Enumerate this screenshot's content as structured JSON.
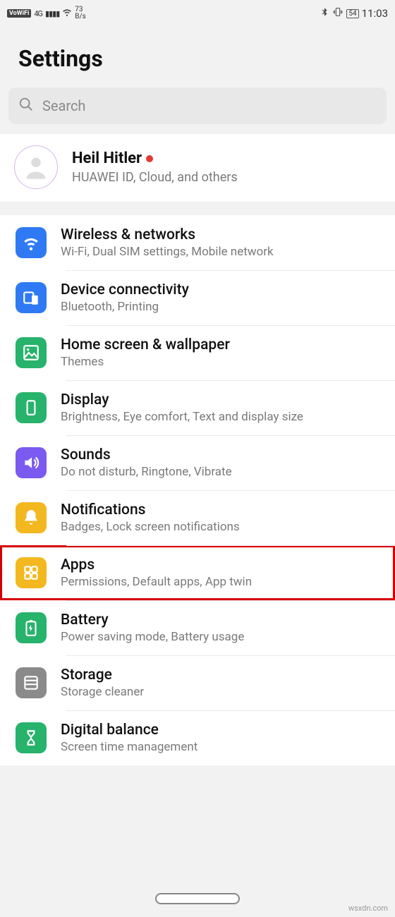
{
  "status": {
    "vowifi": "VoWiFi",
    "network": "4G",
    "rate_top": "73",
    "rate_bottom": "B/s",
    "battery": "54",
    "time": "11:03"
  },
  "header": {
    "title": "Settings"
  },
  "search": {
    "placeholder": "Search"
  },
  "account": {
    "name": "Heil Hitler",
    "sub": "HUAWEI ID, Cloud, and others"
  },
  "items": [
    {
      "id": "wireless",
      "title": "Wireless & networks",
      "sub": "Wi-Fi, Dual SIM settings, Mobile network",
      "color": "#2f7af4",
      "icon": "wifi"
    },
    {
      "id": "device",
      "title": "Device connectivity",
      "sub": "Bluetooth, Printing",
      "color": "#2f7af4",
      "icon": "devices"
    },
    {
      "id": "home",
      "title": "Home screen & wallpaper",
      "sub": "Themes",
      "color": "#27b36b",
      "icon": "image"
    },
    {
      "id": "display",
      "title": "Display",
      "sub": "Brightness, Eye comfort, Text and display size",
      "color": "#27b36b",
      "icon": "phone"
    },
    {
      "id": "sounds",
      "title": "Sounds",
      "sub": "Do not disturb, Ringtone, Vibrate",
      "color": "#7a5af1",
      "icon": "volume"
    },
    {
      "id": "notifications",
      "title": "Notifications",
      "sub": "Badges, Lock screen notifications",
      "color": "#f3b81f",
      "icon": "bell"
    },
    {
      "id": "apps",
      "title": "Apps",
      "sub": "Permissions, Default apps, App twin",
      "color": "#f3b81f",
      "icon": "grid",
      "highlight": true
    },
    {
      "id": "battery",
      "title": "Battery",
      "sub": "Power saving mode, Battery usage",
      "color": "#27b36b",
      "icon": "battery"
    },
    {
      "id": "storage",
      "title": "Storage",
      "sub": "Storage cleaner",
      "color": "#8a8a8a",
      "icon": "storage"
    },
    {
      "id": "digital",
      "title": "Digital balance",
      "sub": "Screen time management",
      "color": "#27b36b",
      "icon": "hourglass"
    }
  ],
  "watermark": "wsxdn.com"
}
